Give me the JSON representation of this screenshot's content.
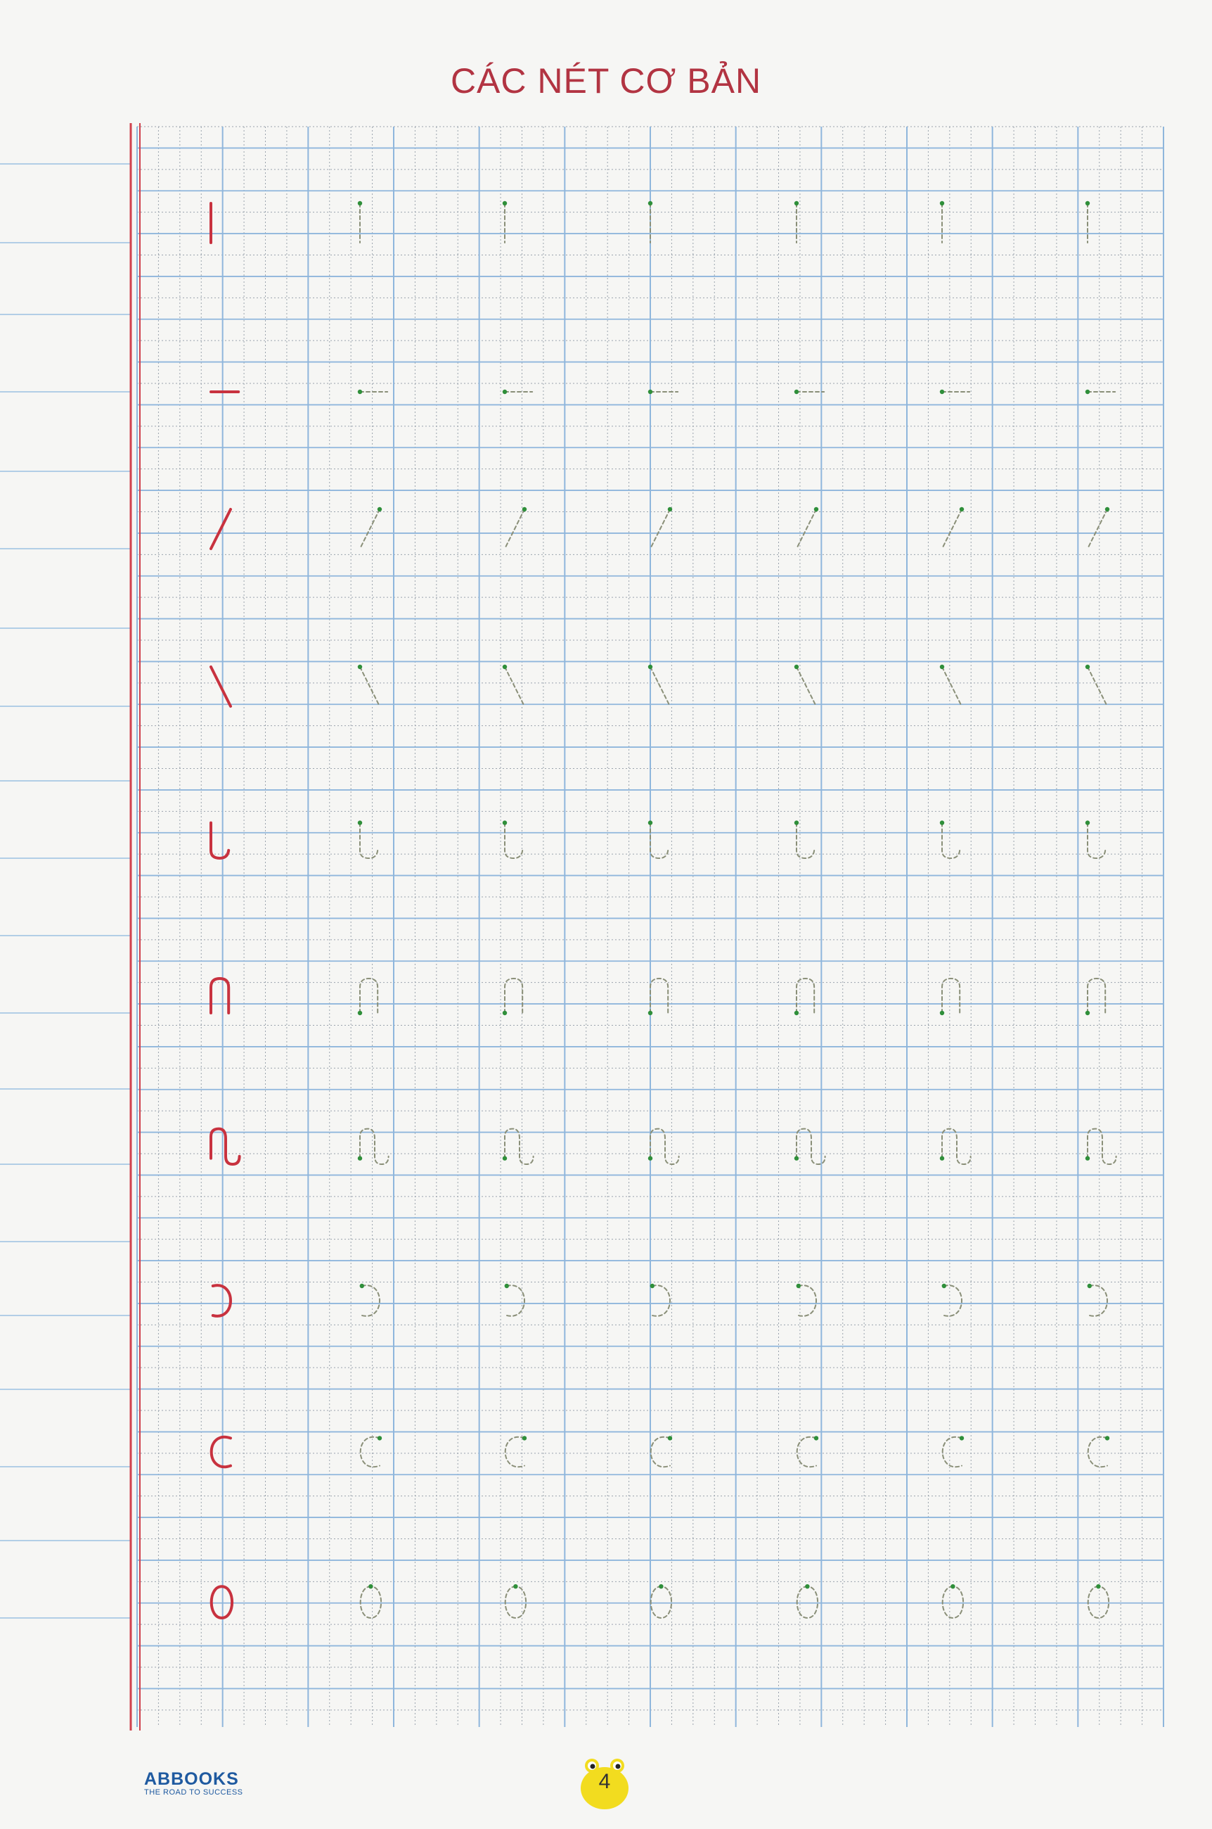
{
  "page": {
    "title": "CÁC NÉT CƠ BẢN",
    "page_number": "4"
  },
  "footer": {
    "brand": "ABBOOKS",
    "tagline": "THE ROAD TO SUCCESS"
  },
  "colors": {
    "title": "#b23442",
    "model_stroke": "#c8323f",
    "trace_stroke": "#8a8f78",
    "start_dot": "#2f8f3a",
    "grid_major": "#8fb6dc",
    "grid_minor": "#9aa3ad",
    "margin_line": "#d0414c",
    "brand": "#1f5aa0",
    "badge": "#f2dc1f"
  },
  "worksheet": {
    "trace_repeats_per_row": 6,
    "rows": [
      {
        "stroke": "vertical-line"
      },
      {
        "stroke": "horizontal-line"
      },
      {
        "stroke": "slanted-right"
      },
      {
        "stroke": "slanted-left"
      },
      {
        "stroke": "hook-bottom"
      },
      {
        "stroke": "hook-top"
      },
      {
        "stroke": "double-hook"
      },
      {
        "stroke": "right-curve"
      },
      {
        "stroke": "left-curve"
      },
      {
        "stroke": "oval"
      }
    ]
  }
}
